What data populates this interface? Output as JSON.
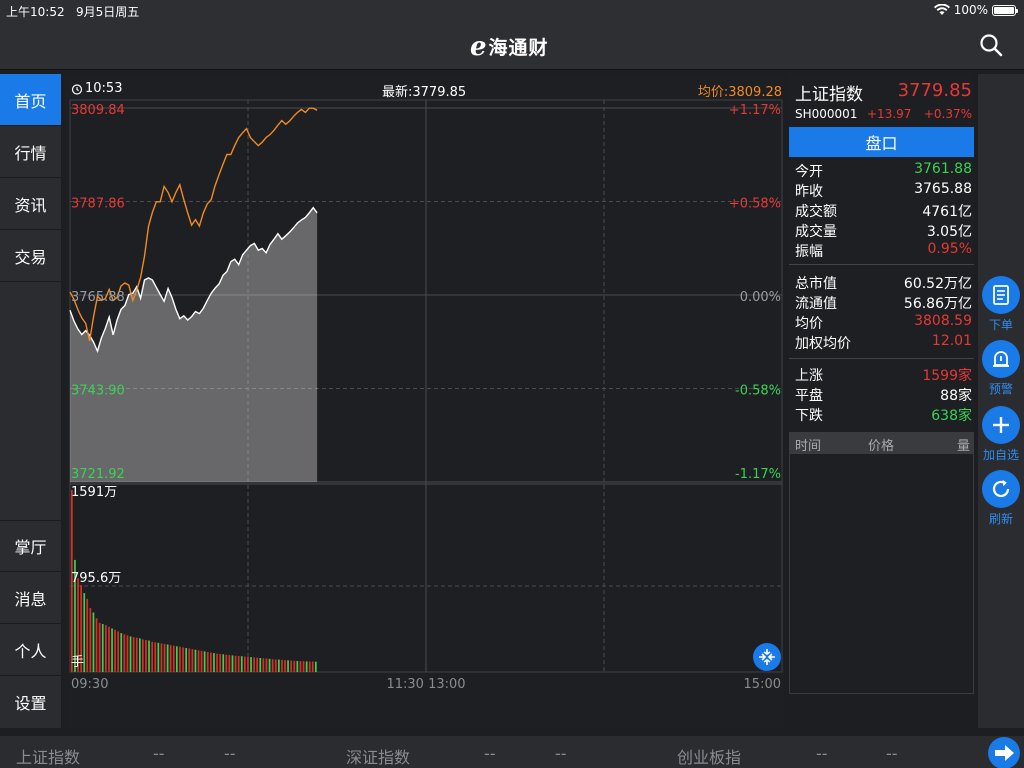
{
  "status_bar": {
    "time": "上午10:52",
    "date": "9月5日周五",
    "battery": "100%"
  },
  "nav": {
    "logo_mark": "e",
    "logo_text": "海通财",
    "search_icon": "search-icon"
  },
  "sidebar": {
    "items": [
      {
        "label": "首页",
        "active": true
      },
      {
        "label": "行情"
      },
      {
        "label": "资讯"
      },
      {
        "label": "交易"
      }
    ],
    "bottom_items": [
      {
        "label": "掌厅"
      },
      {
        "label": "消息"
      },
      {
        "label": "个人"
      },
      {
        "label": "设置"
      }
    ]
  },
  "chart_header": {
    "time": "10:53",
    "latest": "最新:3779.85",
    "avg": "均价:3809.28"
  },
  "chart_data": {
    "type": "line",
    "price_axis_labels": [
      "3809.84",
      "3787.86",
      "3765.88",
      "3743.90",
      "3721.92"
    ],
    "pct_axis_labels": [
      "+1.17%",
      "+0.58%",
      "0.00%",
      "-0.58%",
      "-1.17%"
    ],
    "ylim": [
      3721.92,
      3809.84
    ],
    "x_tick_labels": [
      "09:30",
      "11:30 13:00",
      "15:00"
    ],
    "volume_labels": [
      "1591万",
      "795.6万",
      "手"
    ],
    "volume_max": 1591,
    "series": [
      {
        "color": "#f08a24",
        "values": [
          3766.6,
          3764.9,
          3762.5,
          3760.5,
          3759.2,
          3755.1,
          3760.7,
          3765.6,
          3764.6,
          3765.0,
          3767.2,
          3764.6,
          3765.3,
          3768.0,
          3768.7,
          3768.2,
          3764.6,
          3767.0,
          3770.0,
          3775.0,
          3782.0,
          3785.3,
          3787.8,
          3787.8,
          3791.4,
          3790.0,
          3787.8,
          3790.0,
          3791.8,
          3788.3,
          3785.2,
          3782.3,
          3783.6,
          3782.1,
          3785.2,
          3787.3,
          3788.3,
          3791.6,
          3794.2,
          3796.6,
          3798.9,
          3798.9,
          3801.0,
          3802.9,
          3804.0,
          3805.0,
          3802.9,
          3801.9,
          3801.0,
          3801.8,
          3802.9,
          3803.6,
          3804.6,
          3805.8,
          3806.9,
          3806.0,
          3806.8,
          3807.9,
          3808.8,
          3809.5,
          3808.8,
          3809.8,
          3809.8,
          3809.3
        ]
      },
      {
        "color": "#ffffff",
        "values": [
          3762.3,
          3759.8,
          3757.9,
          3756.6,
          3757.5,
          3756.4,
          3754.8,
          3752.7,
          3755.8,
          3758.0,
          3760.7,
          3756.5,
          3760.0,
          3762.5,
          3763.4,
          3766.0,
          3766.3,
          3767.8,
          3765.1,
          3769.4,
          3769.9,
          3769.4,
          3767.7,
          3766.0,
          3764.4,
          3767.4,
          3765.3,
          3762.5,
          3760.3,
          3761.0,
          3760.0,
          3760.8,
          3762.0,
          3761.5,
          3762.8,
          3764.6,
          3766.3,
          3767.5,
          3768.5,
          3770.5,
          3771.4,
          3773.7,
          3774.3,
          3773.0,
          3775.3,
          3776.4,
          3777.5,
          3778.0,
          3776.4,
          3776.8,
          3775.8,
          3777.8,
          3779.0,
          3780.3,
          3779.0,
          3779.8,
          3780.7,
          3781.7,
          3782.8,
          3783.5,
          3784.1,
          3785.2,
          3786.4,
          3785.2
        ]
      }
    ],
    "volumes": [
      1591,
      980,
      820,
      760,
      690,
      640,
      560,
      520,
      470,
      430,
      420,
      410,
      395,
      380,
      370,
      355,
      340,
      330,
      320,
      310,
      305,
      300,
      295,
      285,
      280,
      275,
      265,
      260,
      255,
      250,
      245,
      240,
      235,
      230,
      225,
      220,
      215,
      210,
      205,
      200,
      195,
      190,
      185,
      180,
      175,
      170,
      165,
      160,
      158,
      155,
      150,
      148,
      145,
      142,
      140,
      138,
      135,
      132,
      130,
      128,
      125,
      122,
      120,
      118,
      115,
      112,
      110,
      108,
      106,
      104,
      102,
      100,
      98,
      96,
      95,
      94,
      93,
      92,
      91,
      90
    ]
  },
  "quote": {
    "name": "上证指数",
    "price": "3779.85",
    "code": "SH000001",
    "change": "+13.97",
    "pct": "+0.37%",
    "tab": "盘口",
    "rows": [
      {
        "label": "今开",
        "value": "3761.88",
        "color": "#39d353"
      },
      {
        "label": "昨收",
        "value": "3765.88",
        "color": "#ffffff"
      },
      {
        "label": "成交额",
        "value": "4761亿",
        "color": "#ffffff"
      },
      {
        "label": "成交量",
        "value": "3.05亿",
        "color": "#ffffff"
      },
      {
        "label": "振幅",
        "value": "0.95%",
        "color": "#e53935"
      }
    ],
    "rows2": [
      {
        "label": "总市值",
        "value": "60.52万亿",
        "color": "#ffffff"
      },
      {
        "label": "流通值",
        "value": "56.86万亿",
        "color": "#ffffff"
      },
      {
        "label": "均价",
        "value": "3808.59",
        "color": "#e53935"
      },
      {
        "label": "加权均价",
        "value": "12.01",
        "color": "#e53935"
      }
    ],
    "rows3": [
      {
        "label": "上涨",
        "value": "1599家",
        "color": "#e53935"
      },
      {
        "label": "平盘",
        "value": "88家",
        "color": "#ffffff"
      },
      {
        "label": "下跌",
        "value": "638家",
        "color": "#39d353"
      }
    ],
    "trade_head": {
      "time": "时间",
      "price": "价格",
      "vol": "量"
    }
  },
  "actions": [
    {
      "label": "下单",
      "icon": "order-icon"
    },
    {
      "label": "预警",
      "icon": "alert-bell-icon"
    },
    {
      "label": "加自选",
      "icon": "plus-icon"
    },
    {
      "label": "刷新",
      "icon": "refresh-icon"
    }
  ],
  "ticker": {
    "items": [
      {
        "name": "上证指数",
        "v1": "--",
        "v2": "--"
      },
      {
        "name": "深证指数",
        "v1": "--",
        "v2": "--"
      },
      {
        "name": "创业板指",
        "v1": "--",
        "v2": "--"
      }
    ],
    "next_icon": "arrow-right-icon"
  }
}
